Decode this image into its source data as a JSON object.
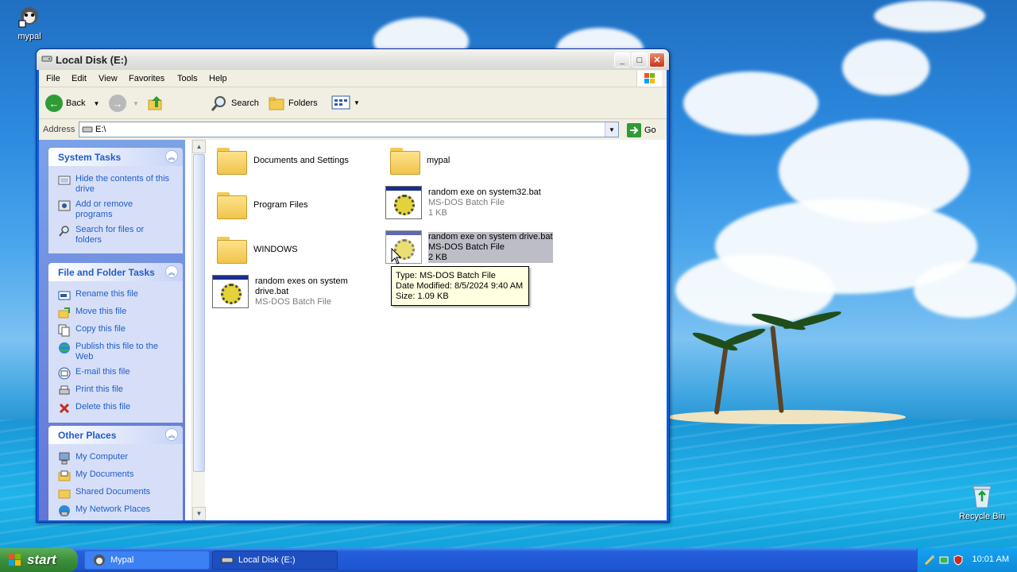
{
  "desktop": {
    "icons": {
      "mypal": "mypal",
      "recycle_bin": "Recycle Bin"
    }
  },
  "window": {
    "title": "Local Disk (E:)",
    "controls": {
      "minimize": "_",
      "maximize": "□",
      "close": "✕"
    }
  },
  "menu": {
    "file": "File",
    "edit": "Edit",
    "view": "View",
    "favorites": "Favorites",
    "tools": "Tools",
    "help": "Help"
  },
  "toolbar": {
    "back": "Back",
    "search": "Search",
    "folders": "Folders"
  },
  "address": {
    "label": "Address",
    "value": "E:\\",
    "go": "Go"
  },
  "left_pane": {
    "system_tasks": {
      "title": "System Tasks",
      "items": [
        {
          "label": "Hide the contents of this drive",
          "icon": "hide-icon"
        },
        {
          "label": "Add or remove programs",
          "icon": "add-remove-icon"
        },
        {
          "label": "Search for files or folders",
          "icon": "search-icon"
        }
      ]
    },
    "file_folder_tasks": {
      "title": "File and Folder Tasks",
      "items": [
        {
          "label": "Rename this file",
          "icon": "rename-icon"
        },
        {
          "label": "Move this file",
          "icon": "move-icon"
        },
        {
          "label": "Copy this file",
          "icon": "copy-icon"
        },
        {
          "label": "Publish this file to the Web",
          "icon": "globe-icon"
        },
        {
          "label": "E-mail this file",
          "icon": "email-icon"
        },
        {
          "label": "Print this file",
          "icon": "print-icon"
        },
        {
          "label": "Delete this file",
          "icon": "delete-icon"
        }
      ]
    },
    "other_places": {
      "title": "Other Places",
      "items": [
        {
          "label": "My Computer",
          "icon": "computer-icon"
        },
        {
          "label": "My Documents",
          "icon": "documents-icon"
        },
        {
          "label": "Shared Documents",
          "icon": "folder-icon"
        },
        {
          "label": "My Network Places",
          "icon": "network-icon"
        }
      ]
    }
  },
  "files": [
    {
      "name": "Documents and Settings",
      "kind": "folder"
    },
    {
      "name": "mypal",
      "kind": "folder"
    },
    {
      "name": "Program Files",
      "kind": "folder"
    },
    {
      "name": "random exe on system32.bat",
      "kind": "bat",
      "type": "MS-DOS Batch File",
      "size": "1 KB"
    },
    {
      "name": "WINDOWS",
      "kind": "folder"
    },
    {
      "name": "random exe on system drive.bat",
      "kind": "bat",
      "type": "MS-DOS Batch File",
      "size": "2 KB",
      "selected": true
    },
    {
      "name_line1": "random exes on system",
      "name_line2": "drive.bat",
      "kind": "bat",
      "type": "MS-DOS Batch File"
    }
  ],
  "tooltip": {
    "type": "Type: MS-DOS Batch File",
    "modified": "Date Modified: 8/5/2024 9:40 AM",
    "size": "Size: 1.09 KB"
  },
  "taskbar": {
    "start": "start",
    "tasks": [
      "Mypal",
      "Local Disk (E:)"
    ],
    "clock": "10:01 AM"
  }
}
